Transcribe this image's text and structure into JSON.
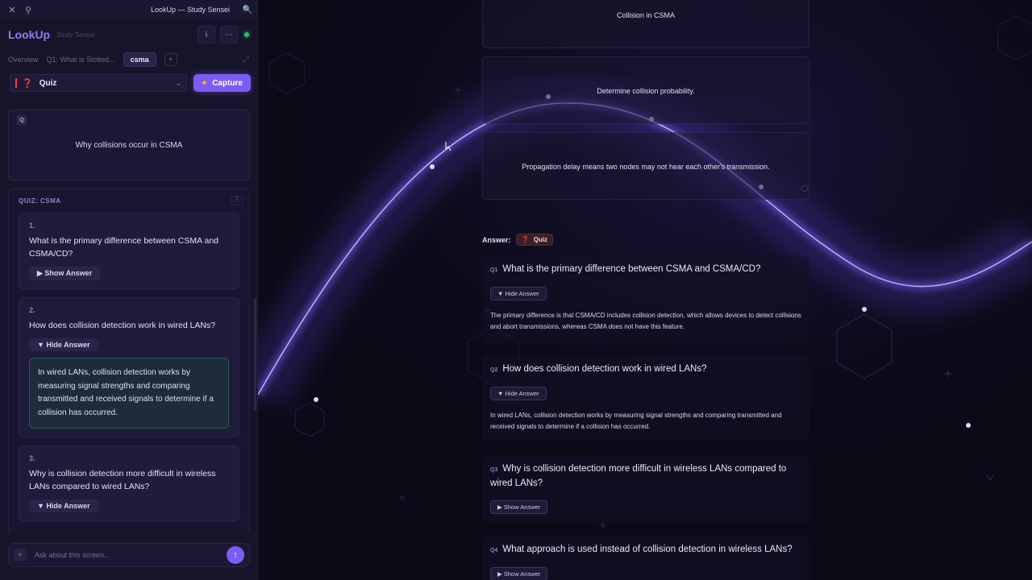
{
  "window": {
    "title": "LookUp — Study Sensei",
    "close_glyph": "✕",
    "pin_glyph": "⚲",
    "search_glyph": "🔍"
  },
  "header": {
    "logo": "LookUp",
    "subtitle": "Study Sensei",
    "info_glyph": "i",
    "more_glyph": "⋯"
  },
  "tabs": {
    "items": [
      "Overview",
      "Q1: What is Slotted..."
    ],
    "active": "csma",
    "add_glyph": "+",
    "expand_glyph": "⤢"
  },
  "mode": {
    "icon": "❓",
    "label": "Quiz",
    "caret": "⌄",
    "capture_icon": "✦",
    "capture_label": "Capture"
  },
  "question_card": {
    "badge": "Q",
    "text": "Why collisions occur in CSMA"
  },
  "quiz": {
    "title": "QUIZ: CSMA",
    "items": [
      {
        "num": "1.",
        "question": "What is the primary difference between CSMA and CSMA/CD?",
        "toggle": "▶ Show Answer"
      },
      {
        "num": "2.",
        "question": "How does collision detection work in wired LANs?",
        "toggle": "▼ Hide Answer",
        "answer": "In wired LANs, collision detection works by measuring signal strengths and comparing transmitted and received signals to determine if a collision has occurred."
      },
      {
        "num": "3.",
        "question": "Why is collision detection more difficult in wireless LANs compared to wired LANs?",
        "toggle": "▼ Hide Answer"
      }
    ]
  },
  "chat": {
    "placeholder": "Ask about this screen...",
    "plus_glyph": "+",
    "send_glyph": "↑"
  },
  "main": {
    "cards": [
      "Collision in CSMA",
      "Determine collision probability.",
      "Propagation delay means two nodes may not hear each other's transmission."
    ],
    "answer_label": "Answer:",
    "answer_badge_icon": "❓",
    "answer_badge": "Quiz",
    "qa": [
      {
        "tag": "Q1",
        "question": "What is the primary difference between CSMA and CSMA/CD?",
        "toggle": "▼ Hide Answer",
        "answer": "The primary difference is that CSMA/CD includes collision detection, which allows devices to detect collisions and abort transmissions, whereas CSMA does not have this feature."
      },
      {
        "tag": "Q2",
        "question": "How does collision detection work in wired LANs?",
        "toggle": "▼ Hide Answer",
        "answer": "In wired LANs, collision detection works by measuring signal strengths and comparing transmitted and received signals to determine if a collision has occurred."
      },
      {
        "tag": "Q3",
        "question": "Why is collision detection more difficult in wireless LANs compared to wired LANs?",
        "toggle": "▶ Show Answer"
      },
      {
        "tag": "Q4",
        "question": "What approach is used instead of collision detection in wireless LANs?",
        "toggle": "▶ Show Answer"
      }
    ]
  },
  "colors": {
    "accent": "#7c5cf4",
    "background": "#0b0a17",
    "sidebar": "#17142a",
    "status": "#22c55e",
    "quiz_red": "#ef4444",
    "answer_box": "#1d2b3a"
  }
}
